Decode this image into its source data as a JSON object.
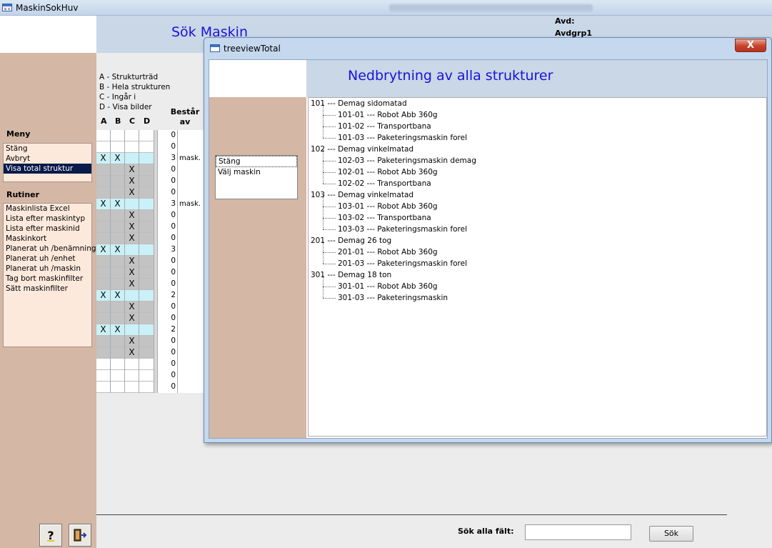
{
  "main_window": {
    "title": "MaskinSokHuv",
    "header_title": "Sök Maskin",
    "avd_label": "Avd:",
    "avd_value": "Avdgrp1"
  },
  "menu": {
    "label": "Meny",
    "items": [
      "Stäng",
      "Avbryt",
      "Visa total struktur"
    ],
    "selected": "Visa total struktur"
  },
  "rutiner": {
    "label": "Rutiner",
    "items": [
      "Maskinlista Excel",
      "Lista efter maskintyp",
      "Lista efter maskinid",
      "Maskinkort",
      "Planerat uh /benämning",
      "Planerat uh /enhet",
      "Planerat uh /maskin",
      "Tag bort maskinfilter",
      "Sätt maskinfilter"
    ]
  },
  "legend": {
    "a": "A - Strukturträd",
    "b": "B - Hela strukturen",
    "c": "C - Ingår i",
    "d": "D - Visa bilder"
  },
  "grid": {
    "col_a": "A",
    "col_b": "B",
    "col_c": "C",
    "col_d": "D",
    "bestar_line1": "Består",
    "bestar_line2": "av",
    "rows": [
      {
        "style": "white",
        "a": "",
        "b": "",
        "c": "",
        "count": "0",
        "text": ""
      },
      {
        "style": "white",
        "a": "",
        "b": "",
        "c": "",
        "count": "0",
        "text": ""
      },
      {
        "style": "cyan",
        "a": "X",
        "b": "X",
        "c": "",
        "count": "3",
        "text": "mask."
      },
      {
        "style": "gray",
        "a": "",
        "b": "",
        "c": "X",
        "count": "0",
        "text": ""
      },
      {
        "style": "gray",
        "a": "",
        "b": "",
        "c": "X",
        "count": "0",
        "text": ""
      },
      {
        "style": "gray",
        "a": "",
        "b": "",
        "c": "X",
        "count": "0",
        "text": ""
      },
      {
        "style": "cyan",
        "a": "X",
        "b": "X",
        "c": "",
        "count": "3",
        "text": "mask."
      },
      {
        "style": "gray",
        "a": "",
        "b": "",
        "c": "X",
        "count": "0",
        "text": ""
      },
      {
        "style": "gray",
        "a": "",
        "b": "",
        "c": "X",
        "count": "0",
        "text": ""
      },
      {
        "style": "gray",
        "a": "",
        "b": "",
        "c": "X",
        "count": "0",
        "text": ""
      },
      {
        "style": "cyan",
        "a": "X",
        "b": "X",
        "c": "",
        "count": "3",
        "text": ""
      },
      {
        "style": "gray",
        "a": "",
        "b": "",
        "c": "X",
        "count": "0",
        "text": ""
      },
      {
        "style": "gray",
        "a": "",
        "b": "",
        "c": "X",
        "count": "0",
        "text": ""
      },
      {
        "style": "gray",
        "a": "",
        "b": "",
        "c": "X",
        "count": "0",
        "text": ""
      },
      {
        "style": "cyan",
        "a": "X",
        "b": "X",
        "c": "",
        "count": "2",
        "text": ""
      },
      {
        "style": "gray",
        "a": "",
        "b": "",
        "c": "X",
        "count": "0",
        "text": ""
      },
      {
        "style": "gray",
        "a": "",
        "b": "",
        "c": "X",
        "count": "0",
        "text": ""
      },
      {
        "style": "cyan",
        "a": "X",
        "b": "X",
        "c": "",
        "count": "2",
        "text": ""
      },
      {
        "style": "gray",
        "a": "",
        "b": "",
        "c": "X",
        "count": "0",
        "text": ""
      },
      {
        "style": "gray",
        "a": "",
        "b": "",
        "c": "X",
        "count": "0",
        "text": ""
      },
      {
        "style": "white",
        "a": "",
        "b": "",
        "c": "",
        "count": "0",
        "text": ""
      },
      {
        "style": "white",
        "a": "",
        "b": "",
        "c": "",
        "count": "0",
        "text": ""
      },
      {
        "style": "white",
        "a": "",
        "b": "",
        "c": "",
        "count": "0",
        "text": ""
      }
    ]
  },
  "search": {
    "label": "Sök alla fält:",
    "value": "",
    "button": "Sök"
  },
  "bottom_icons": [
    "help-icon",
    "exit-door-icon"
  ],
  "popup": {
    "title": "treeviewTotal",
    "close_label": "X",
    "header_title": "Nedbrytning av alla strukturer",
    "list_items": [
      "Stäng",
      "Välj maskin"
    ],
    "tree": [
      {
        "label": "101 --- Demag sidomatad",
        "children": [
          "101-01 --- Robot Abb 360g",
          "101-02 --- Transportbana",
          "101-03 --- Paketeringsmaskin forel"
        ]
      },
      {
        "label": "102 --- Demag vinkelmatad",
        "children": [
          "102-03 --- Paketeringsmaskin demag",
          "102-01 --- Robot Abb 360g",
          "102-02 --- Transportbana"
        ]
      },
      {
        "label": "103 --- Demag vinkelmatad",
        "children": [
          "103-01 --- Robot Abb 360g",
          "103-02 --- Transportbana",
          "103-03 --- Paketeringsmaskin forel"
        ]
      },
      {
        "label": "201 --- Demag 26 tog",
        "children": [
          "201-01 --- Robot Abb 360g",
          "201-03 --- Paketeringsmaskin forel"
        ]
      },
      {
        "label": "301 --- Demag 18 ton",
        "children": [
          "301-01 --- Robot Abb 360g",
          "301-03 --- Paketeringsmaskin"
        ]
      }
    ]
  },
  "colors": {
    "title_blue": "#1a12d9",
    "menu_brown": "#d4b7a5",
    "header_blue": "#c9d7e6",
    "selected_row_cyan": "#c9f1f7",
    "list_bg": "#fde9dc"
  }
}
